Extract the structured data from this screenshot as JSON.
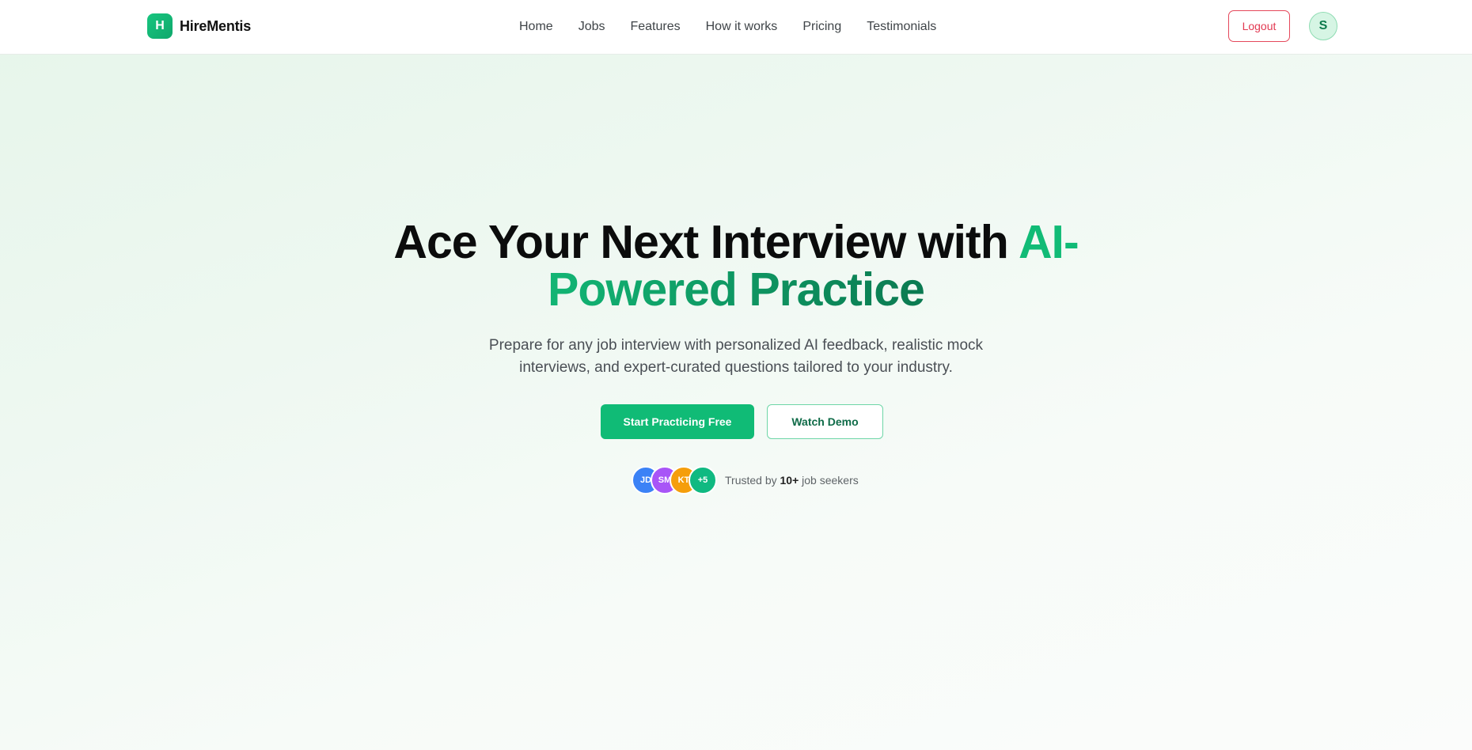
{
  "nav": {
    "brand_initial": "H",
    "brand_name": "HireMentis",
    "links": [
      "Home",
      "Jobs",
      "Features",
      "How it works",
      "Pricing",
      "Testimonials"
    ],
    "logout_label": "Logout",
    "user_initial": "S"
  },
  "hero": {
    "title_part1": "Ace Your Next Interview with",
    "title_highlight1": "AI-",
    "title_highlight2": "Powered Practice",
    "subtitle": "Prepare for any job interview with personalized AI feedback, realistic mock interviews, and expert-curated questions tailored to your industry.",
    "primary_cta": "Start Practicing Free",
    "secondary_cta": "Watch Demo"
  },
  "trust": {
    "avatars": [
      {
        "initials": "JD",
        "color": "#3b82f6"
      },
      {
        "initials": "SM",
        "color": "#a855f7"
      },
      {
        "initials": "KT",
        "color": "#f59e0b"
      },
      {
        "initials": "+5",
        "color": "#10b981"
      }
    ],
    "prefix": "Trusted by",
    "count": "10+",
    "suffix": "job seekers"
  },
  "colors": {
    "accent": "#10bb76",
    "logout": "#e23a52"
  }
}
